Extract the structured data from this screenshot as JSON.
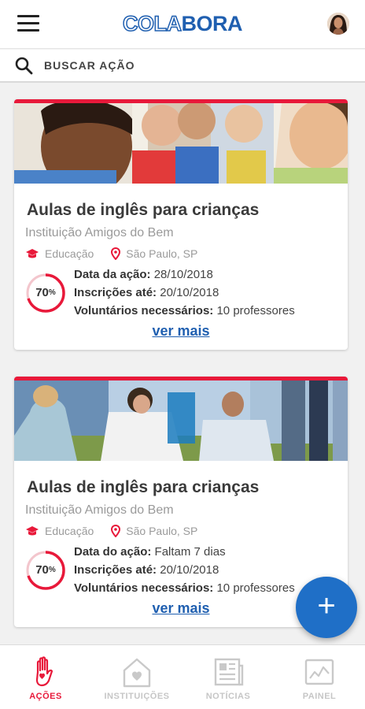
{
  "header": {
    "logo_part1": "COLA",
    "logo_part2": "BORA"
  },
  "search": {
    "placeholder": "BUSCAR AÇÃO"
  },
  "cards": [
    {
      "title": "Aulas de inglês para crianças",
      "institution": "Instituição Amigos do Bem",
      "category": "Educação",
      "location": "São Paulo, SP",
      "progress": "70",
      "progress_unit": "%",
      "date_label": "Data da ação:",
      "date_value": "28/10/2018",
      "signup_label": "Inscrições até:",
      "signup_value": "20/10/2018",
      "volunteers_label": "Voluntários necessários:",
      "volunteers_value": "10 professores",
      "more_label": "ver mais"
    },
    {
      "title": "Aulas de inglês para crianças",
      "institution": "Instituição Amigos do Bem",
      "category": "Educação",
      "location": "São Paulo, SP",
      "progress": "70",
      "progress_unit": "%",
      "date_label": "Data do ação:",
      "date_value": "Faltam 7 dias",
      "signup_label": "Inscrições até:",
      "signup_value": "20/10/2018",
      "volunteers_label": "Voluntários necessários:",
      "volunteers_value": "10 professores",
      "more_label": "ver mais"
    }
  ],
  "fab": {
    "label": "+"
  },
  "nav": {
    "acoes": "AÇÕES",
    "instituicoes": "INSTITUIÇÕES",
    "noticias": "NOTÍCIAS",
    "painel": "PAINEL"
  },
  "colors": {
    "accent": "#e8193a",
    "brand": "#1f5fb0",
    "fab": "#1f6fc7"
  }
}
